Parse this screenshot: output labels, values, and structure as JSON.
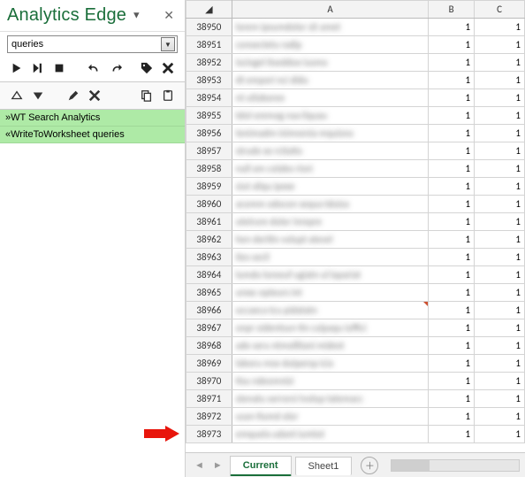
{
  "pane": {
    "title": "Analytics Edge",
    "close_tooltip": "Close",
    "combo_value": "queries",
    "tasks": [
      {
        "label": "»WT Search Analytics"
      },
      {
        "label": "«WriteToWorksheet queries"
      }
    ]
  },
  "sheet": {
    "columns": [
      "A",
      "B",
      "C"
    ],
    "rows": [
      {
        "n": 38950,
        "a": "lorem ipsumdolor sit amet",
        "b": 1,
        "c": 1
      },
      {
        "n": 38951,
        "a": "consectetu radip",
        "b": 1,
        "c": 1
      },
      {
        "n": 38952,
        "a": "iscingel itseddoe iusmo",
        "b": 1,
        "c": 1
      },
      {
        "n": 38953,
        "a": "dt empori nci didu",
        "b": 1,
        "c": 1
      },
      {
        "n": 38954,
        "a": "nt utlaboree",
        "b": 1,
        "c": 1
      },
      {
        "n": 38955,
        "a": "tdol oremag naa liquau",
        "b": 1,
        "c": 1
      },
      {
        "n": 38956,
        "a": "tenimadm inimvenia mquisno",
        "b": 1,
        "c": 1
      },
      {
        "n": 38957,
        "a": "strude xe rcitatio",
        "b": 1,
        "c": 1
      },
      {
        "n": 38958,
        "a": "null am colabo risni",
        "b": 1,
        "c": 1
      },
      {
        "n": 38959,
        "a": "siut aliqu ipexe",
        "b": 1,
        "c": 1
      },
      {
        "n": 38960,
        "a": "acomm odocon sequa tduisa",
        "b": 1,
        "c": 1
      },
      {
        "n": 38961,
        "a": "uteirure dolor inrepre",
        "b": 1,
        "c": 1
      },
      {
        "n": 38962,
        "a": "hen deritin volupt atevel",
        "b": 1,
        "c": 1
      },
      {
        "n": 38963,
        "a": "ites secil",
        "b": 1,
        "c": 1
      },
      {
        "n": 38964,
        "a": "lumdo loreeuf ugiatn ul lapariat",
        "b": 1,
        "c": 1
      },
      {
        "n": 38965,
        "a": "urexc epteurs int",
        "b": 1,
        "c": 1
      },
      {
        "n": 38966,
        "a": "occaeca tcu pidatatn",
        "b": 1,
        "c": 1,
        "marker": true
      },
      {
        "n": 38967,
        "a": "onpr oidentsun tin culpaqu ioffici",
        "b": 1,
        "c": 1
      },
      {
        "n": 38968,
        "a": "ade seru ntmollitani midest",
        "b": 1,
        "c": 1
      },
      {
        "n": 38969,
        "a": "laboru mse dutpersp icia",
        "b": 1,
        "c": 1
      },
      {
        "n": 38970,
        "a": "tisu ndeomnisi",
        "b": 1,
        "c": 1
      },
      {
        "n": 38971,
        "a": "stenatu serrorsi tvolup tatemacc",
        "b": 1,
        "c": 1
      },
      {
        "n": 38972,
        "a": "usan tiumd olor",
        "b": 1,
        "c": 1
      },
      {
        "n": 38973,
        "a": "emquela udant iumtot",
        "b": 1,
        "c": 1
      }
    ],
    "tabs": {
      "nav_prev": "◄",
      "nav_next": "►",
      "items": [
        {
          "label": "Current",
          "active": true
        },
        {
          "label": "Sheet1",
          "active": false
        }
      ],
      "add_tooltip": "New sheet"
    }
  }
}
